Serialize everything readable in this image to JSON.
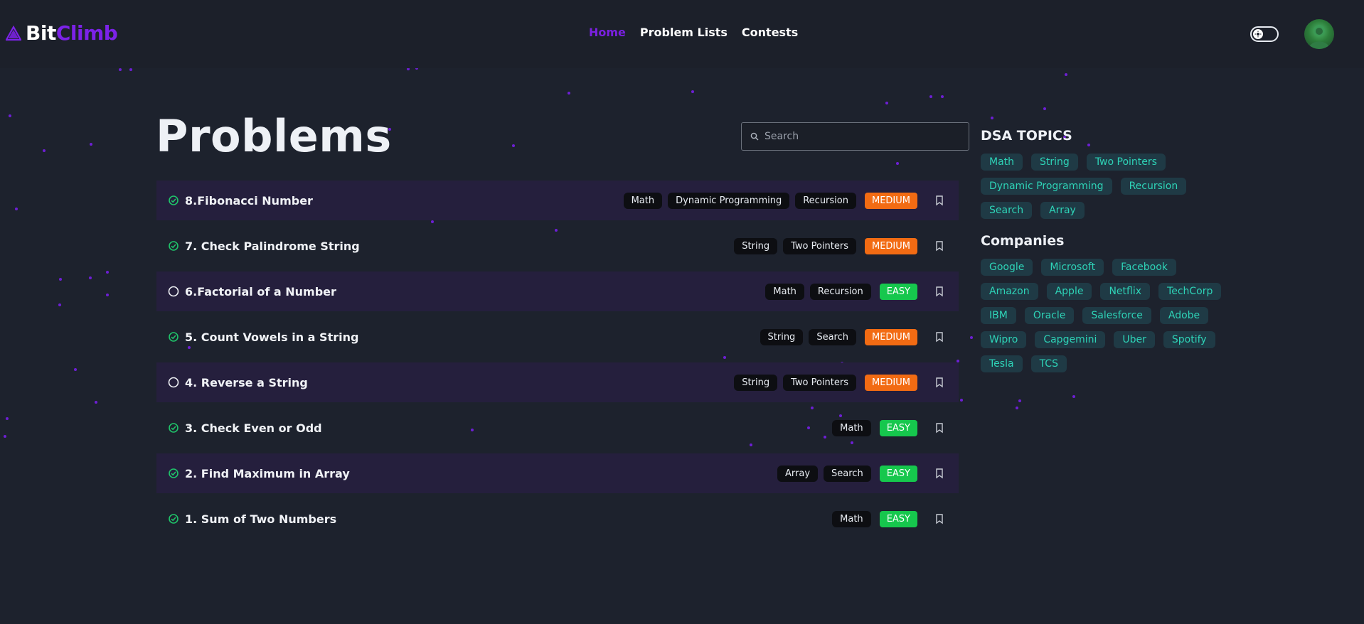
{
  "brand": {
    "part1": "Bit",
    "part2": "Climb"
  },
  "nav": {
    "links": [
      "Home",
      "Problem Lists",
      "Contests"
    ],
    "active": "Home"
  },
  "page": {
    "title": "Problems"
  },
  "search": {
    "placeholder": "Search",
    "value": ""
  },
  "problems": [
    {
      "title": "8.Fibonacci Number",
      "solved": true,
      "tags": [
        "Math",
        "Dynamic Programming",
        "Recursion"
      ],
      "difficulty": "MEDIUM"
    },
    {
      "title": "7. Check Palindrome String",
      "solved": true,
      "tags": [
        "String",
        "Two Pointers"
      ],
      "difficulty": "MEDIUM"
    },
    {
      "title": "6.Factorial of a Number",
      "solved": false,
      "tags": [
        "Math",
        "Recursion"
      ],
      "difficulty": "EASY"
    },
    {
      "title": "5. Count Vowels in a String",
      "solved": true,
      "tags": [
        "String",
        "Search"
      ],
      "difficulty": "MEDIUM"
    },
    {
      "title": "4. Reverse a String",
      "solved": false,
      "tags": [
        "String",
        "Two Pointers"
      ],
      "difficulty": "MEDIUM"
    },
    {
      "title": "3. Check Even or Odd",
      "solved": true,
      "tags": [
        "Math"
      ],
      "difficulty": "EASY"
    },
    {
      "title": "2. Find Maximum in Array",
      "solved": true,
      "tags": [
        "Array",
        "Search"
      ],
      "difficulty": "EASY"
    },
    {
      "title": "1. Sum of Two Numbers",
      "solved": true,
      "tags": [
        "Math"
      ],
      "difficulty": "EASY"
    }
  ],
  "sidebar": {
    "topics_heading": "DSA TOPICS",
    "topics": [
      "Math",
      "String",
      "Two Pointers",
      "Dynamic Programming",
      "Recursion",
      "Search",
      "Array"
    ],
    "companies_heading": "Companies",
    "companies": [
      "Google",
      "Microsoft",
      "Facebook",
      "Amazon",
      "Apple",
      "Netflix",
      "TechCorp",
      "IBM",
      "Oracle",
      "Salesforce",
      "Adobe",
      "Wipro",
      "Capgemini",
      "Uber",
      "Spotify",
      "Tesla",
      "TCS"
    ]
  },
  "colors": {
    "background": "#1d222d",
    "accent": "#7c22e8",
    "medium": "#f26b13",
    "easy": "#16c74d",
    "chip_text": "#2ed3b7",
    "solved_check": "#1fc46a"
  },
  "icons": {
    "logo": "triangle-logo-icon",
    "search": "search-icon",
    "solved": "check-circle-icon",
    "unsolved": "circle-icon",
    "bookmark": "bookmark-icon",
    "theme": "sun-icon"
  }
}
